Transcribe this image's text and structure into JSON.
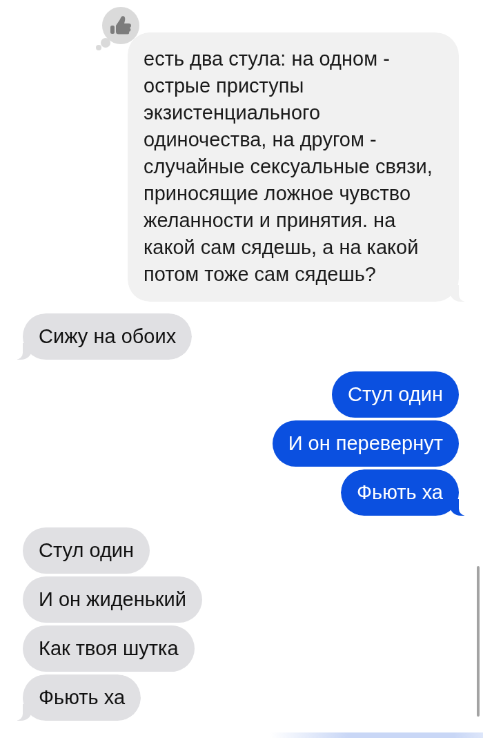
{
  "messages": [
    {
      "kind": "pale",
      "liked": true,
      "text": "есть два стула: на одном - острые приступы экзистенциального одиночества, на другом - случайные сексуальные связи, приносящие ложное чувство желанности и принятия. на какой сам сядешь, а на какой потом тоже сам сядешь?"
    },
    {
      "kind": "incoming",
      "liked": false,
      "text": "Сижу на обоих"
    },
    {
      "kind": "outgoing",
      "liked": false,
      "text": "Стул один"
    },
    {
      "kind": "outgoing",
      "liked": false,
      "text": "И он перевернут"
    },
    {
      "kind": "outgoing",
      "liked": false,
      "text": "Фьють ха"
    },
    {
      "kind": "incoming",
      "liked": false,
      "text": "Стул один"
    },
    {
      "kind": "incoming",
      "liked": false,
      "text": "И он жиденький"
    },
    {
      "kind": "incoming",
      "liked": false,
      "text": "Как твоя шутка"
    },
    {
      "kind": "incoming",
      "liked": false,
      "text": "Фьють ха"
    }
  ]
}
